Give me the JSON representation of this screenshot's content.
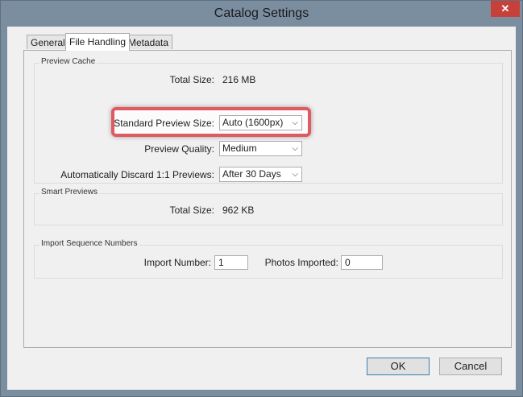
{
  "window": {
    "title": "Catalog Settings",
    "close_glyph": "✕"
  },
  "tabs": [
    "General",
    "File Handling",
    "Metadata"
  ],
  "preview_cache": {
    "group_label": "Preview Cache",
    "total_size_label": "Total Size:",
    "total_size_value": "216 MB",
    "standard_preview_label": "Standard Preview Size:",
    "standard_preview_value": "Auto (1600px)",
    "preview_quality_label": "Preview Quality:",
    "preview_quality_value": "Medium",
    "discard_label": "Automatically Discard 1:1 Previews:",
    "discard_value": "After 30 Days"
  },
  "smart_previews": {
    "group_label": "Smart Previews",
    "total_size_label": "Total Size:",
    "total_size_value": "962 KB"
  },
  "import_sequence": {
    "group_label": "Import Sequence Numbers",
    "import_number_label": "Import Number:",
    "import_number_value": "1",
    "photos_imported_label": "Photos Imported:",
    "photos_imported_value": "0"
  },
  "buttons": {
    "ok": "OK",
    "cancel": "Cancel"
  },
  "icons": {
    "dropdown": "chevron-down-icon"
  },
  "colors": {
    "titlebar": "#7b8ea0",
    "highlight": "#e05a63",
    "close": "#c7403a"
  }
}
